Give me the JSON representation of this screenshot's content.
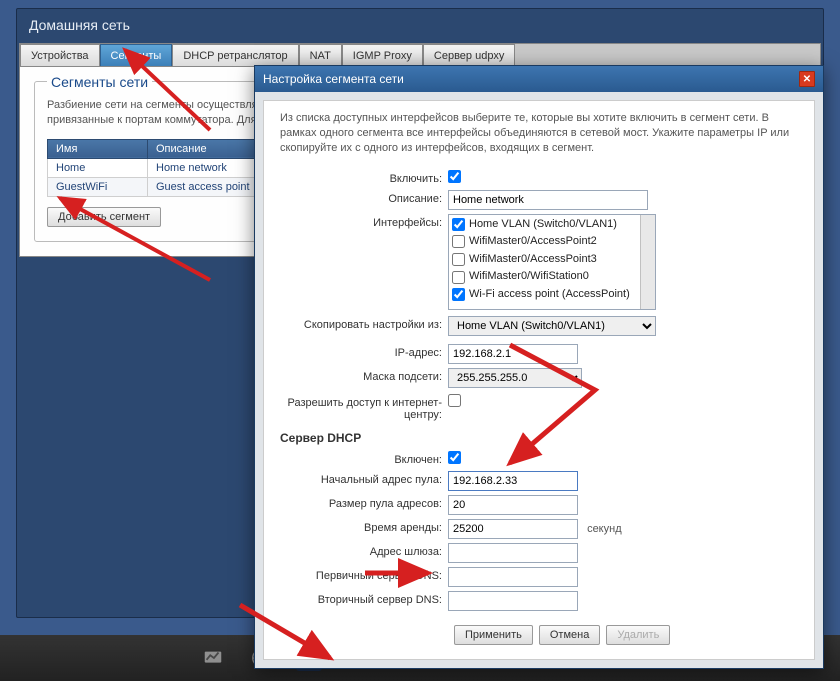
{
  "page_title": "Домашняя сеть",
  "tabs": [
    "Устройства",
    "Сегменты",
    "DHCP ретранслятор",
    "NAT",
    "IGMP Proxy",
    "Сервер udpxy"
  ],
  "active_tab_index": 1,
  "fieldset_legend": "Сегменты сети",
  "segments_desc": "Разбиение сети на сегменты осуществляется объединяет порты встроенного коммутатора схемы предоставления услуг, для подключения привязанные к портам коммутатора. Для",
  "segments_table": {
    "headers": [
      "Имя",
      "Описание"
    ],
    "rows": [
      [
        "Home",
        "Home network"
      ],
      [
        "GuestWiFi",
        "Guest access point"
      ]
    ]
  },
  "add_segment_btn": "Добавить сегмент",
  "dialog": {
    "title": "Настройка сегмента сети",
    "intro": "Из списка доступных интерфейсов выберите те, которые вы хотите включить в сегмент сети. В рамках одного сегмента все интерфейсы объединяются в сетевой мост. Укажите параметры IP или скопируйте их с одного из интерфейсов, входящих в сегмент.",
    "labels": {
      "enable": "Включить:",
      "description": "Описание:",
      "interfaces": "Интерфейсы:",
      "copy_from": "Скопировать настройки из:",
      "ip": "IP-адрес:",
      "mask": "Маска подсети:",
      "allow_access": "Разрешить доступ к интернет-центру:",
      "dhcp_header": "Сервер DHCP",
      "dhcp_on": "Включен:",
      "pool_start": "Начальный адрес пула:",
      "pool_size": "Размер пула адресов:",
      "lease": "Время аренды:",
      "lease_unit": "секунд",
      "gateway": "Адрес шлюза:",
      "dns1": "Первичный сервер DNS:",
      "dns2": "Вторичный сервер DNS:"
    },
    "values": {
      "enable": true,
      "description": "Home network",
      "interfaces": [
        {
          "label": "Home VLAN (Switch0/VLAN1)",
          "checked": true
        },
        {
          "label": "WifiMaster0/AccessPoint2",
          "checked": false
        },
        {
          "label": "WifiMaster0/AccessPoint3",
          "checked": false
        },
        {
          "label": "WifiMaster0/WifiStation0",
          "checked": false
        },
        {
          "label": "Wi-Fi access point (AccessPoint)",
          "checked": true
        }
      ],
      "copy_from": "Home VLAN (Switch0/VLAN1)",
      "ip": "192.168.2.1",
      "mask": "255.255.255.0",
      "allow_access": false,
      "dhcp_on": true,
      "pool_start": "192.168.2.33",
      "pool_size": "20",
      "lease": "25200",
      "gateway": "",
      "dns1": "",
      "dns2": ""
    },
    "buttons": {
      "apply": "Применить",
      "cancel": "Отмена",
      "delete": "Удалить"
    }
  }
}
